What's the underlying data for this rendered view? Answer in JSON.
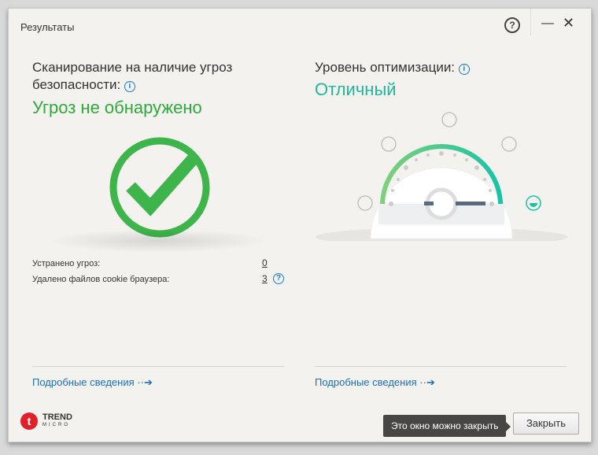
{
  "window": {
    "title": "Результаты",
    "help": "?",
    "minimize": "—",
    "close": "✕"
  },
  "left": {
    "heading_line1": "Сканирование на наличие угроз",
    "heading_line2": "безопасности:",
    "info": "i",
    "status": "Угроз не обнаружено",
    "status_color": "#2eaa3c",
    "rows": [
      {
        "label": "Устранено угроз:",
        "value": "0"
      },
      {
        "label": "Удалено файлов cookie браузера:",
        "value": "3",
        "help": "?"
      }
    ],
    "details_link": "Подробные сведения"
  },
  "right": {
    "heading": "Уровень оптимизации:",
    "info": "i",
    "status": "Отличный",
    "status_color": "#1fb89a",
    "gauge_level": 1.0,
    "details_link": "Подробные сведения"
  },
  "footer": {
    "logo_line1": "TREND",
    "logo_line2": "MICRO",
    "tooltip": "Это окно можно закрыть",
    "close_button": "Закрыть"
  }
}
